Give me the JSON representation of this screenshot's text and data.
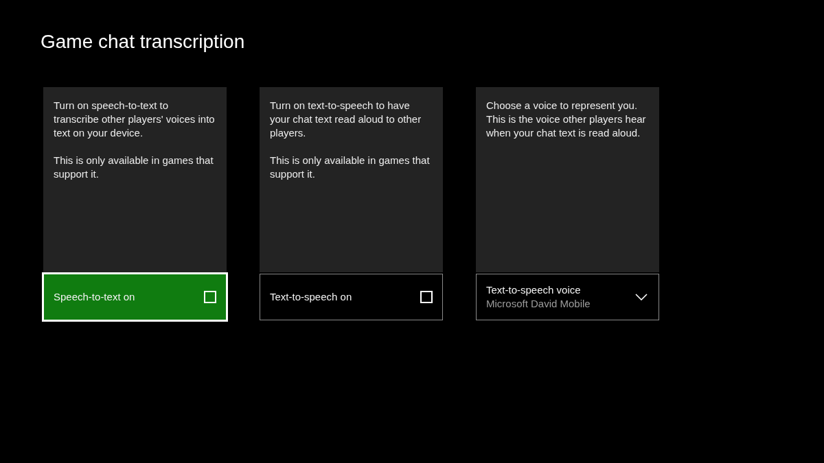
{
  "title": "Game chat transcription",
  "cards": [
    {
      "description": [
        "Turn on speech-to-text to transcribe other players' voices into text on your device.",
        "This is only available in games that support it."
      ],
      "control": {
        "kind": "toggle",
        "label": "Speech-to-text on",
        "checked": false,
        "focused": true
      }
    },
    {
      "description": [
        "Turn on text-to-speech to have your chat text read aloud to other players.",
        "This is only available in games that support it."
      ],
      "control": {
        "kind": "toggle",
        "label": "Text-to-speech on",
        "checked": false,
        "focused": false
      }
    },
    {
      "description": [
        "Choose a voice to represent you. This is the voice other players hear when your chat text is read aloud."
      ],
      "control": {
        "kind": "dropdown",
        "label": "Text-to-speech voice",
        "value": "Microsoft David Mobile",
        "focused": false
      }
    }
  ]
}
